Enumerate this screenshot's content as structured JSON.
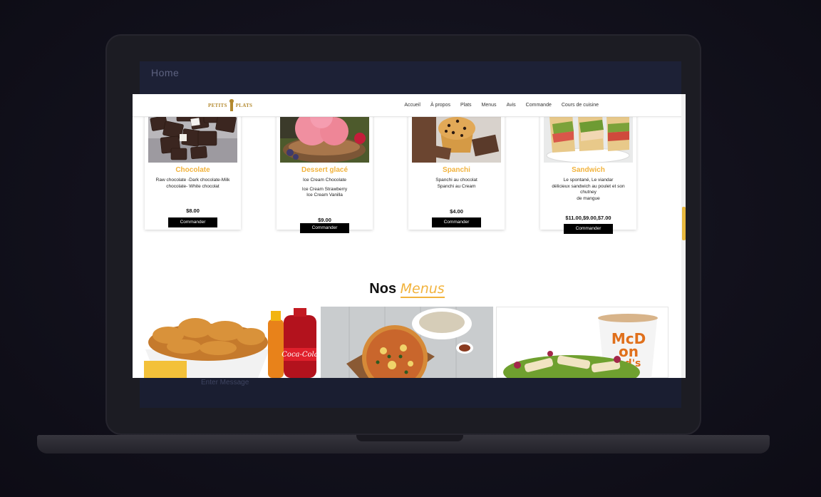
{
  "mockup": {
    "bg_window_title": "Home",
    "bg_message_placeholder": "Enter Message"
  },
  "header": {
    "logo_left": "PETITS",
    "logo_right": "PLATS",
    "nav": [
      "Accueil",
      "À propos",
      "Plats",
      "Menus",
      "Avis",
      "Commande",
      "Cours de cuisine"
    ]
  },
  "products": [
    {
      "title": "Chocolate",
      "description": [
        "Raw chocolate -Dark chocolate-Milk",
        "chocolate- White chocolat"
      ],
      "price": "$8.00",
      "button": "Commander"
    },
    {
      "title": "Dessert glacé",
      "description": [
        "Ice Cream Chocolate",
        "",
        "Ice Cream Strawberry",
        "Ice Cream Vanilla"
      ],
      "price": "$9.00",
      "button": "Commander"
    },
    {
      "title": "Spanchi",
      "description": [
        "Spanchi au chocolat",
        "Spanchi au Cream"
      ],
      "price": "$4.00",
      "button": "Commander"
    },
    {
      "title": "Sandwich",
      "description": [
        "Le spontané, Le viandar",
        "délicieux sandwich au poulet et son chutney",
        "de mangue"
      ],
      "price": "$11.00,$9.00,$7.00",
      "button": "Commander"
    }
  ],
  "menus_section": {
    "title_plain": "Nos",
    "title_accent": "Menus"
  },
  "colors": {
    "accent": "#f2b33d",
    "button_bg": "#000000",
    "scroll_thumb": "#e8b83e"
  }
}
